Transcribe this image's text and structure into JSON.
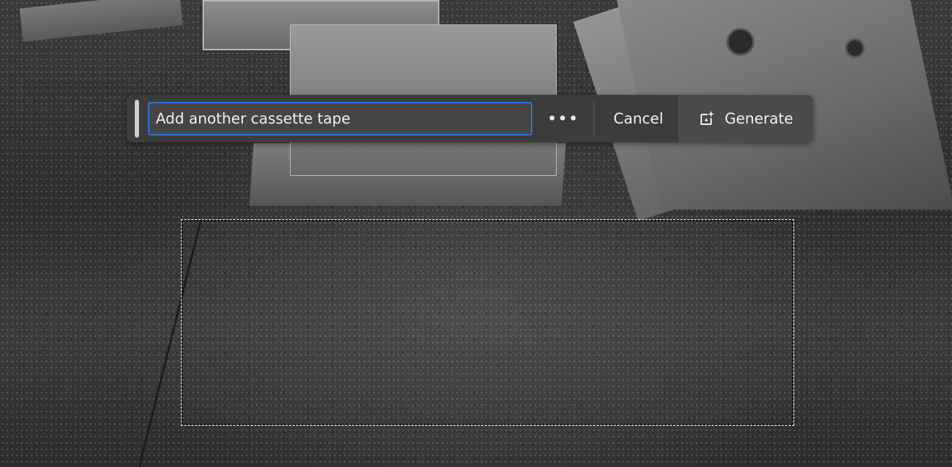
{
  "taskbar": {
    "prompt_value": "Add another cassette tape",
    "more_label": "•••",
    "cancel_label": "Cancel",
    "generate_label": "Generate"
  },
  "icons": {
    "grip": "drag-handle-icon",
    "more": "more-options-icon",
    "generate": "generative-fill-icon"
  },
  "colors": {
    "accent": "#2a74d6",
    "bar_background": "#3c3c3c",
    "generate_background": "#4a4a4a"
  }
}
